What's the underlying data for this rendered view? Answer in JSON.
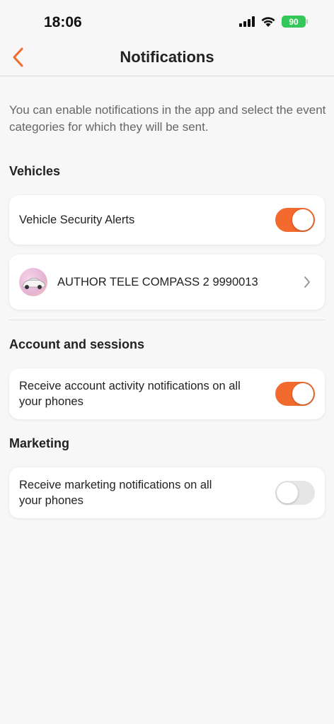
{
  "status": {
    "time": "18:06",
    "battery": "90"
  },
  "nav": {
    "title": "Notifications"
  },
  "intro": "You can enable notifications in the app and select the event categories for which they will be sent.",
  "vehicles": {
    "title": "Vehicles",
    "security_alerts_label": "Vehicle Security Alerts",
    "security_alerts_on": true,
    "vehicle_name": "AUTHOR TELE COMPASS 2 9990013"
  },
  "account": {
    "title": "Account and sessions",
    "activity_label": "Receive account activity notifications on all your phones",
    "activity_on": true
  },
  "marketing": {
    "title": "Marketing",
    "marketing_label": "Receive marketing notifications on all your phones",
    "marketing_on": false
  },
  "colors": {
    "accent": "#f26a2e",
    "background": "#f7f7f7",
    "toggle_off": "#e6e6e6"
  }
}
